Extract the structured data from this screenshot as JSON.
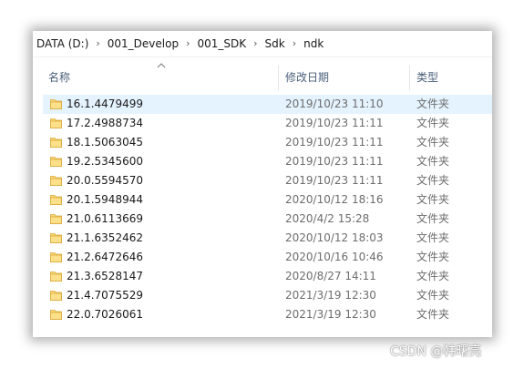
{
  "breadcrumb": {
    "items": [
      "DATA (D:)",
      "001_Develop",
      "001_SDK",
      "Sdk",
      "ndk"
    ],
    "separator": "›"
  },
  "columns": {
    "name": "名称",
    "date": "修改日期",
    "type": "类型"
  },
  "rows": [
    {
      "name": "16.1.4479499",
      "date": "2019/10/23 11:10",
      "type": "文件夹",
      "selected": true
    },
    {
      "name": "17.2.4988734",
      "date": "2019/10/23 11:11",
      "type": "文件夹"
    },
    {
      "name": "18.1.5063045",
      "date": "2019/10/23 11:11",
      "type": "文件夹"
    },
    {
      "name": "19.2.5345600",
      "date": "2019/10/23 11:11",
      "type": "文件夹"
    },
    {
      "name": "20.0.5594570",
      "date": "2019/10/23 11:11",
      "type": "文件夹"
    },
    {
      "name": "20.1.5948944",
      "date": "2020/10/12 18:16",
      "type": "文件夹"
    },
    {
      "name": "21.0.6113669",
      "date": "2020/4/2 15:28",
      "type": "文件夹"
    },
    {
      "name": "21.1.6352462",
      "date": "2020/10/12 18:03",
      "type": "文件夹"
    },
    {
      "name": "21.2.6472646",
      "date": "2020/10/16 10:46",
      "type": "文件夹"
    },
    {
      "name": "21.3.6528147",
      "date": "2020/8/27 14:11",
      "type": "文件夹"
    },
    {
      "name": "21.4.7075529",
      "date": "2021/3/19 12:30",
      "type": "文件夹"
    },
    {
      "name": "22.0.7026061",
      "date": "2021/3/19 12:30",
      "type": "文件夹"
    }
  ],
  "icons": {
    "folder": "folder-icon",
    "sort": "sort-up-icon"
  },
  "colors": {
    "folder": "#f8d775",
    "selected_row": "#e5f3ff",
    "header_text": "#4c607a"
  },
  "watermark": "CSDN @韩曙亮"
}
